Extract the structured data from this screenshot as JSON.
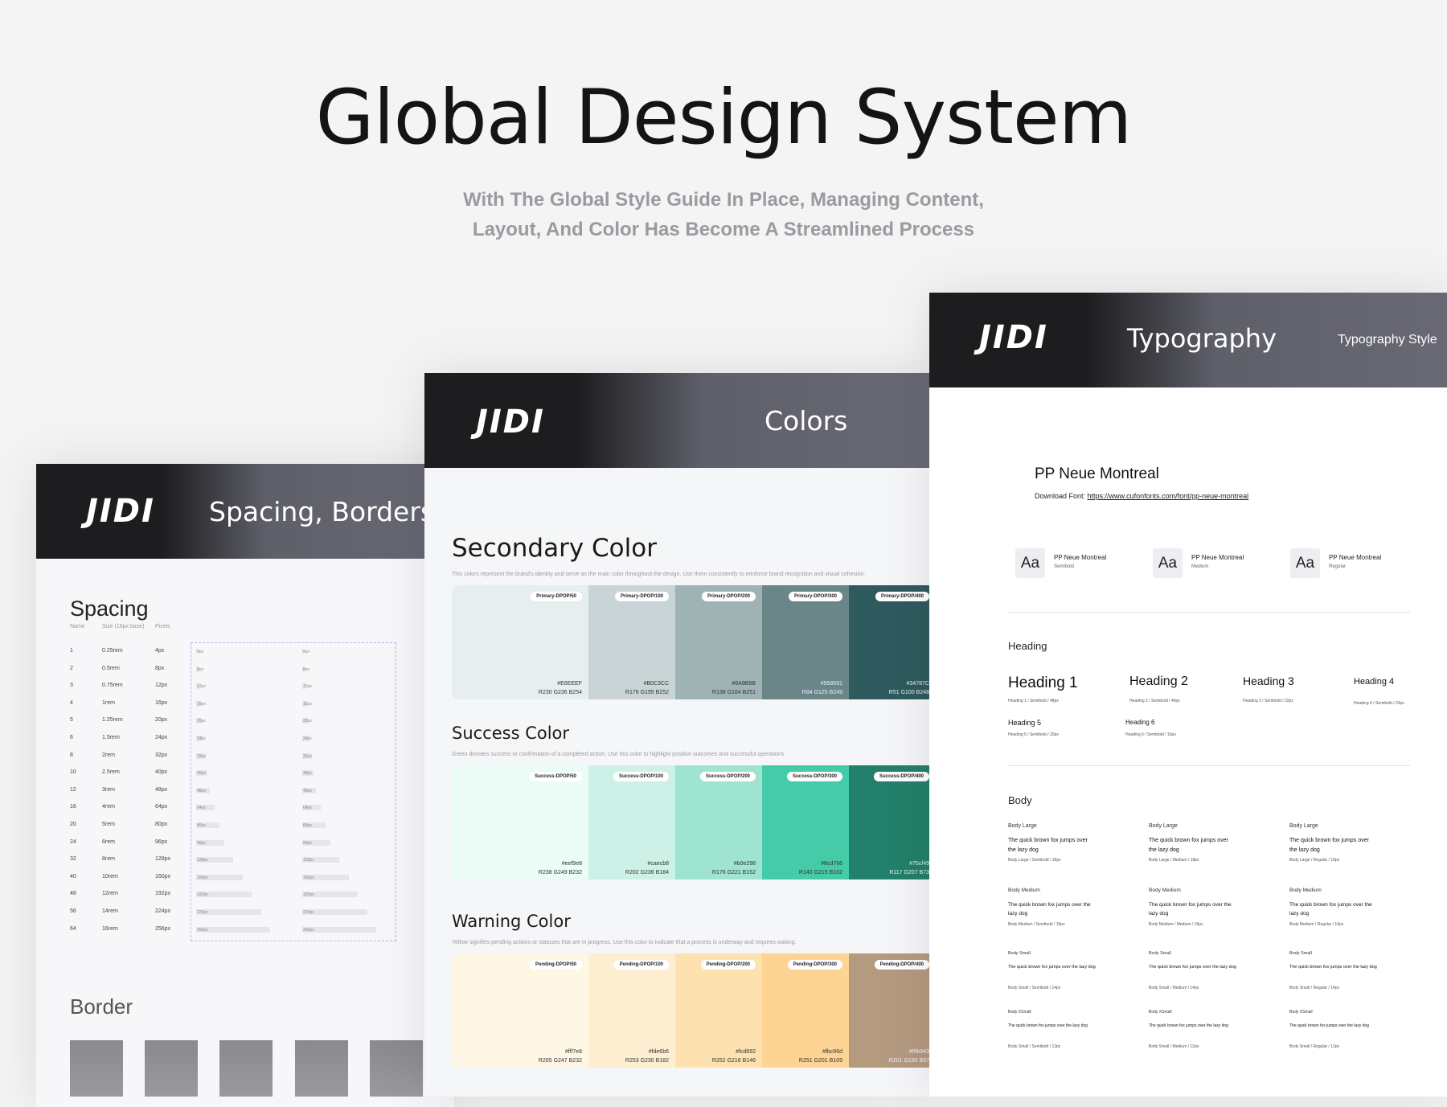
{
  "hero": {
    "title": "Global Design System",
    "subtitle_line1": "With The Global Style Guide In Place, Managing Content,",
    "subtitle_line2": "Layout, And Color Has Become A Streamlined Process"
  },
  "brand": {
    "logo": "JIDI"
  },
  "spacing_card": {
    "header_title": "Spacing, Borders, S",
    "section_title": "Spacing",
    "columns": [
      "Name",
      "Size (16px base)",
      "Pixels"
    ],
    "rows": [
      [
        "1",
        "0.25rem",
        "4px"
      ],
      [
        "2",
        "0.5rem",
        "8px"
      ],
      [
        "3",
        "0.75rem",
        "12px"
      ],
      [
        "4",
        "1rem",
        "16px"
      ],
      [
        "5",
        "1.25rem",
        "20px"
      ],
      [
        "6",
        "1.5rem",
        "24px"
      ],
      [
        "8",
        "2rem",
        "32px"
      ],
      [
        "10",
        "2.5rem",
        "40px"
      ],
      [
        "12",
        "3rem",
        "48px"
      ],
      [
        "16",
        "4rem",
        "64px"
      ],
      [
        "20",
        "5rem",
        "80px"
      ],
      [
        "24",
        "6rem",
        "96px"
      ],
      [
        "32",
        "8rem",
        "128px"
      ],
      [
        "40",
        "10rem",
        "160px"
      ],
      [
        "48",
        "12rem",
        "192px"
      ],
      [
        "56",
        "14rem",
        "224px"
      ],
      [
        "64",
        "16rem",
        "256px"
      ]
    ],
    "border_title": "Border"
  },
  "colors_card": {
    "header_title": "Colors",
    "sections": [
      {
        "title": "Secondary Color",
        "desc": "This colors represent the brand's identity and serve as the main color throughout the design. Use them consistently to reinforce brand recognition and visual cohesion.",
        "swatches": [
          {
            "tag": "Primary-DPOP/50",
            "hex": "#E6EEEF",
            "rgb": "R230 G236 B254",
            "color": "#e6eeef"
          },
          {
            "tag": "Primary-DPOP/100",
            "hex": "#B0C3CC",
            "rgb": "R176 G195 B252",
            "color": "#c9d4d6"
          },
          {
            "tag": "Primary-DPOP/200",
            "hex": "#8A9B9B",
            "rgb": "R138 G164 B251",
            "color": "#9fb2b4"
          },
          {
            "tag": "Primary-DPOP/300",
            "hex": "#558691",
            "rgb": "R84 G125 B249",
            "color": "#6a8689"
          },
          {
            "tag": "Primary-DPOP/400",
            "hex": "#34787C",
            "rgb": "R51 G100 B248",
            "color": "#2f5b5e"
          }
        ]
      },
      {
        "title": "Success Color",
        "desc": "Green denotes success or confirmation of a completed action. Use this color to highlight positive outcomes and successful operations",
        "swatches": [
          {
            "tag": "Success-DPOP/50",
            "hex": "#eef9e8",
            "rgb": "R238 G249 B232",
            "color": "#ebfbf6"
          },
          {
            "tag": "Success-DPOP/100",
            "hex": "#caecb8",
            "rgb": "R202 G236 B184",
            "color": "#cdf1e6"
          },
          {
            "tag": "Success-DPOP/200",
            "hex": "#b0e298",
            "rgb": "R176 G221 B152",
            "color": "#9fe3d1"
          },
          {
            "tag": "Success-DPOP/300",
            "hex": "#8cd766",
            "rgb": "R140 G215 B102",
            "color": "#45cba7"
          },
          {
            "tag": "Success-DPOP/400",
            "hex": "#75cf49",
            "rgb": "R117 G207 B73",
            "color": "#23806a"
          }
        ]
      },
      {
        "title": "Warning Color",
        "desc": "Yellow signifies pending actions or statuses that are in progress. Use this color to indicate that a process is underway and requires waiting.",
        "swatches": [
          {
            "tag": "Pending-DPOP/50",
            "hex": "#fff7e8",
            "rgb": "R265 G247 B232",
            "color": "#fff7e6"
          },
          {
            "tag": "Pending-DPOP/100",
            "hex": "#fde6b6",
            "rgb": "R253 G230 B182",
            "color": "#fdeed2"
          },
          {
            "tag": "Pending-DPOP/200",
            "hex": "#fcd892",
            "rgb": "R252 G216 B146",
            "color": "#fde2b0"
          },
          {
            "tag": "Pending-DPOP/300",
            "hex": "#fbc96d",
            "rgb": "R251 G201 B109",
            "color": "#fdd493"
          },
          {
            "tag": "Pending-DPOP/400",
            "hex": "#f9b943",
            "rgb": "R201 G185 B67",
            "color": "#b49a7f"
          }
        ]
      }
    ]
  },
  "typo_card": {
    "header_title": "Typography",
    "header_right": "Typography Style",
    "font_name": "PP Neue Montreal",
    "download_label": "Download Font: ",
    "download_url": "https://www.cufonfonts.com/font/pp-neue-montreal",
    "weights": [
      {
        "aa": "Aa",
        "name": "PP Neue Montreal",
        "weight": "Semibold"
      },
      {
        "aa": "Aa",
        "name": "PP Neue Montreal",
        "weight": "Medium"
      },
      {
        "aa": "Aa",
        "name": "PP Neue Montreal",
        "weight": "Regular"
      }
    ],
    "heading_section": "Heading",
    "headings": [
      {
        "label": "Heading 1",
        "meta": "Heading 1 / Semibold / 48px"
      },
      {
        "label": "Heading 2",
        "meta": "Heading 2 / Semibold / 40px"
      },
      {
        "label": "Heading 3",
        "meta": "Heading 3 / Semibold / 32px"
      },
      {
        "label": "Heading 4",
        "meta": "Heading 4 / Semibold / 24px"
      },
      {
        "label": "Heading 5",
        "meta": "Heading 5 / Semibold / 20px"
      },
      {
        "label": "Heading 6",
        "meta": "Heading 6 / Semibold / 16px"
      }
    ],
    "body_section": "Body",
    "body_sample": "The quick brown fox jumps over the lazy dog",
    "body_rows": [
      {
        "label": "Body Large",
        "metas": [
          "Body Large / Semibold / 18px",
          "Body Large / Medium / 18px",
          "Body Large / Regular / 18px"
        ]
      },
      {
        "label": "Body Medium",
        "metas": [
          "Body Medium / Semibold / 16px",
          "Body Medium / Medium / 16px",
          "Body Medium / Regular / 16px"
        ]
      },
      {
        "label": "Body Small",
        "metas": [
          "Body Small / Semibold / 14px",
          "Body Small / Medium / 14px",
          "Body Small / Regular / 14px"
        ]
      },
      {
        "label": "Body XSmall",
        "metas": [
          "Body Small / Semibold / 12px",
          "Body Small / Medium / 12px",
          "Body Small / Regular / 12px"
        ]
      }
    ]
  }
}
